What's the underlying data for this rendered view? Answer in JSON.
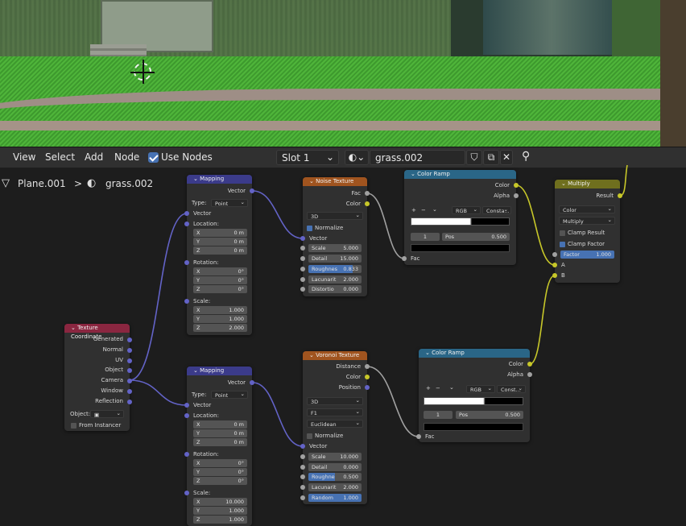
{
  "header": {
    "menu": [
      "View",
      "Select",
      "Add",
      "Node"
    ],
    "use_nodes_label": "Use Nodes",
    "slot": "Slot 1",
    "material": "grass.002"
  },
  "breadcrumb": {
    "object": "Plane.001",
    "sep": ">",
    "material": "grass.002"
  },
  "nodes": {
    "mapping1": {
      "title": "Mapping",
      "out_vector": "Vector",
      "type_label": "Type:",
      "type_value": "Point",
      "in_vector": "Vector",
      "location": "Location:",
      "rotation": "Rotation:",
      "scale": "Scale:",
      "loc": [
        [
          "X",
          "0 m"
        ],
        [
          "Y",
          "0 m"
        ],
        [
          "Z",
          "0 m"
        ]
      ],
      "rot": [
        [
          "X",
          "0°"
        ],
        [
          "Y",
          "0°"
        ],
        [
          "Z",
          "0°"
        ]
      ],
      "scl": [
        [
          "X",
          "1.000"
        ],
        [
          "Y",
          "1.000"
        ],
        [
          "Z",
          "2.000"
        ]
      ]
    },
    "mapping2": {
      "title": "Mapping",
      "out_vector": "Vector",
      "type_label": "Type:",
      "type_value": "Point",
      "in_vector": "Vector",
      "location": "Location:",
      "rotation": "Rotation:",
      "scale": "Scale:",
      "loc": [
        [
          "X",
          "0 m"
        ],
        [
          "Y",
          "0 m"
        ],
        [
          "Z",
          "0 m"
        ]
      ],
      "rot": [
        [
          "X",
          "0°"
        ],
        [
          "Y",
          "0°"
        ],
        [
          "Z",
          "0°"
        ]
      ],
      "scl": [
        [
          "X",
          "10.000"
        ],
        [
          "Y",
          "1.000"
        ],
        [
          "Z",
          "1.000"
        ]
      ]
    },
    "noise": {
      "title": "Noise Texture",
      "out_fac": "Fac",
      "out_color": "Color",
      "dim": "3D",
      "normalize": "Normalize",
      "in_vector": "Vector",
      "fields": [
        [
          "Scale",
          "5.000"
        ],
        [
          "Detail",
          "15.000"
        ],
        [
          "Roughnes",
          "0.833"
        ],
        [
          "Lacunarit",
          "2.000"
        ],
        [
          "Distortio",
          "0.000"
        ]
      ]
    },
    "voronoi": {
      "title": "Voronoi Texture",
      "out_distance": "Distance",
      "out_color": "Color",
      "out_position": "Position",
      "dim": "3D",
      "feature": "F1",
      "metric": "Euclidean",
      "normalize": "Normalize",
      "in_vector": "Vector",
      "fields": [
        [
          "Scale",
          "10.000"
        ],
        [
          "Detail",
          "0.000"
        ],
        [
          "Roughne",
          "0.500"
        ],
        [
          "Lacunarit",
          "2.000"
        ],
        [
          "Random",
          "1.000"
        ]
      ]
    },
    "ramp1": {
      "title": "Color Ramp",
      "out_color": "Color",
      "out_alpha": "Alpha",
      "plus": "+",
      "minus": "−",
      "chev": "⌄",
      "mode": "RGB",
      "interp": "Consta...",
      "index": "1",
      "pos_label": "Pos",
      "pos": "0.500",
      "in_fac": "Fac"
    },
    "ramp2": {
      "title": "Color Ramp",
      "out_color": "Color",
      "out_alpha": "Alpha",
      "plus": "+",
      "minus": "−",
      "chev": "⌄",
      "mode": "RGB",
      "interp": "Const...",
      "index": "1",
      "pos_label": "Pos",
      "pos": "0.500",
      "in_fac": "Fac"
    },
    "multiply": {
      "title": "Multiply",
      "out_result": "Result",
      "type": "Color",
      "blend": "Multiply",
      "clamp_result": "Clamp Result",
      "clamp_factor": "Clamp Factor",
      "factor_label": "Factor",
      "factor": "1.000",
      "in_a": "A",
      "in_b": "B"
    },
    "texcoord": {
      "title": "Texture Coordinate",
      "outputs": [
        "Generated",
        "Normal",
        "UV",
        "Object",
        "Camera",
        "Window",
        "Reflection"
      ],
      "object_label": "Object:",
      "from_instancer": "From Instancer"
    }
  },
  "colors": {
    "vector_socket": "#6363c7",
    "color_socket": "#c7c729",
    "float_socket": "#a1a1a1",
    "mapping_head": "#3b3b8a",
    "texture_head": "#a0541f",
    "ramp_head": "#2a6687",
    "mix_head": "#6f6f1e",
    "input_head": "#8a2640"
  }
}
